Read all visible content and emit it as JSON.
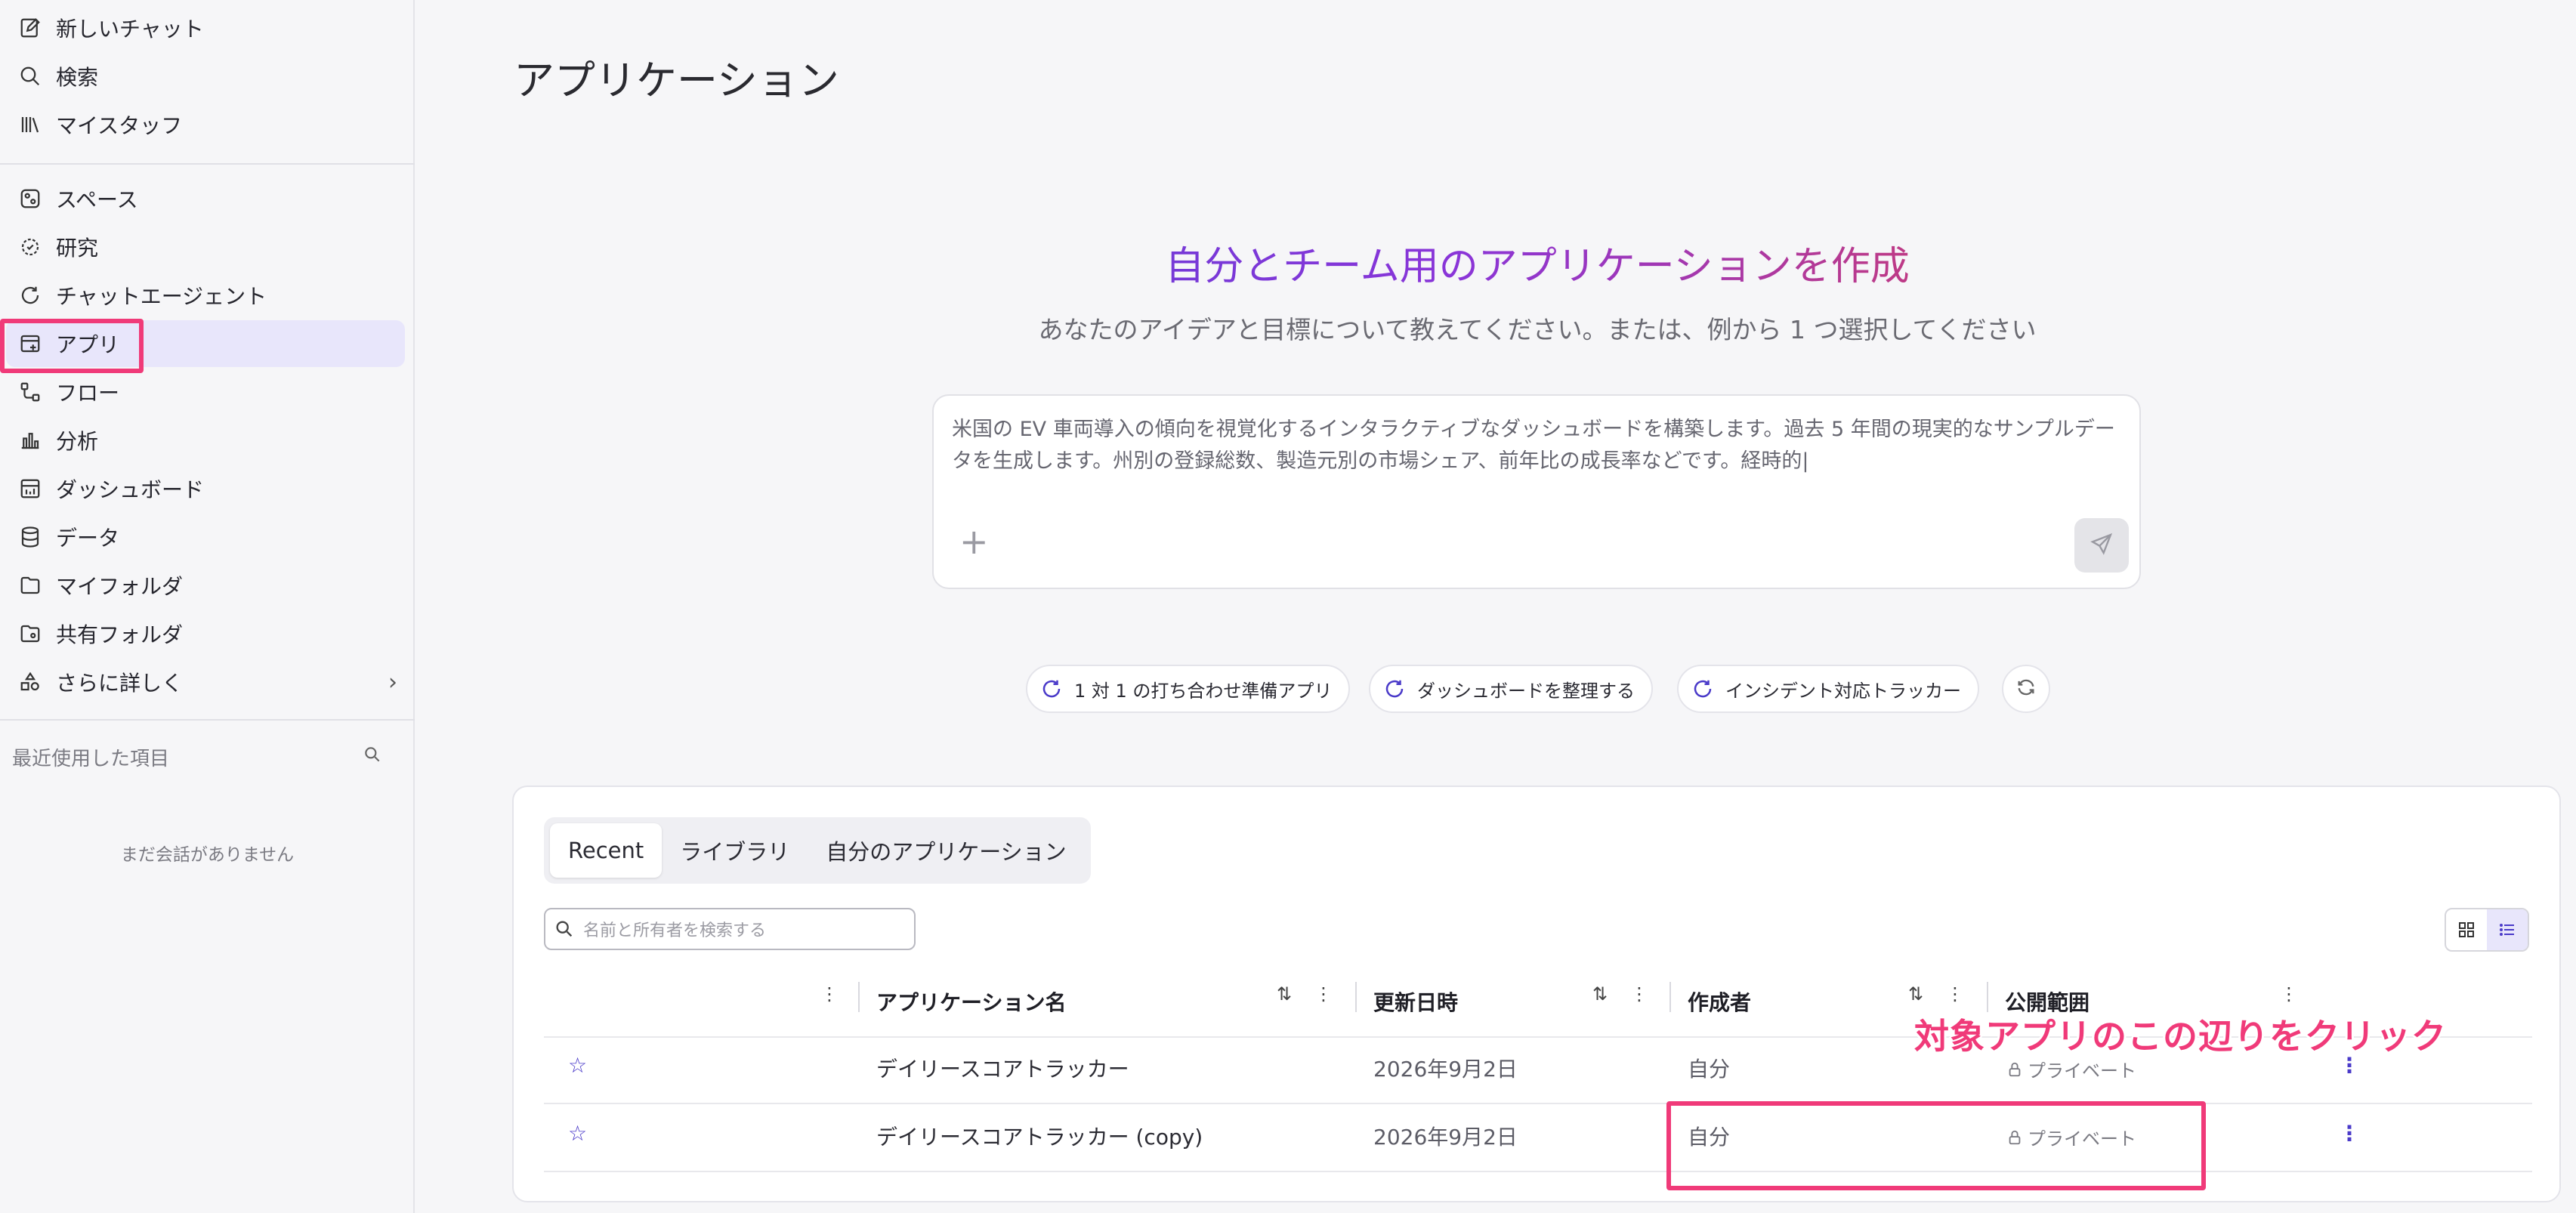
{
  "sidebar": {
    "items": [
      {
        "label": "新しいチャット",
        "icon": "edit-icon"
      },
      {
        "label": "検索",
        "icon": "search-icon"
      },
      {
        "label": "マイスタッフ",
        "icon": "library-icon"
      },
      {
        "label": "スペース",
        "icon": "spaces-icon"
      },
      {
        "label": "研究",
        "icon": "research-icon"
      },
      {
        "label": "チャットエージェント",
        "icon": "chat-agent-icon"
      },
      {
        "label": "アプリ",
        "icon": "app-icon"
      },
      {
        "label": "フロー",
        "icon": "flow-icon"
      },
      {
        "label": "分析",
        "icon": "chart-icon"
      },
      {
        "label": "ダッシュボード",
        "icon": "dashboard-icon"
      },
      {
        "label": "データ",
        "icon": "database-icon"
      },
      {
        "label": "マイフォルダ",
        "icon": "folder-icon"
      },
      {
        "label": "共有フォルダ",
        "icon": "shared-folder-icon"
      },
      {
        "label": "さらに詳しく",
        "icon": "shapes-icon"
      }
    ],
    "recent_label": "最近使用した項目",
    "empty_text": "まだ会話がありません"
  },
  "main": {
    "page_title": "アプリケーション",
    "hero_title": "自分とチーム用のアプリケーションを作成",
    "hero_subtitle": "あなたのアイデアと目標について教えてください。または、例から 1 つ選択してください",
    "prompt_text": "米国の EV 車両導入の傾向を視覚化するインタラクティブなダッシュボードを構築します。過去 5 年間の現実的なサンプルデータを生成します。州別の登録総数、製造元別の市場シェア、前年比の成長率などです。経時的|",
    "suggestions": [
      "1 対 1 の打ち合わせ準備アプリ",
      "ダッシュボードを整理する",
      "インシデント対応トラッカー"
    ]
  },
  "apps": {
    "tabs": [
      "Recent",
      "ライブラリ",
      "自分のアプリケーション"
    ],
    "search_placeholder": "名前と所有者を検索する",
    "columns": [
      "アプリケーション名",
      "更新日時",
      "作成者",
      "公開範囲"
    ],
    "rows": [
      {
        "name": "デイリースコアトラッカー",
        "updated": "2026年9月2日",
        "creator": "自分",
        "visibility": "プライベート"
      },
      {
        "name": "デイリースコアトラッカー (copy)",
        "updated": "2026年9月2日",
        "creator": "自分",
        "visibility": "プライベート"
      }
    ]
  },
  "annotation": {
    "text": "対象アプリのこの辺りをクリック",
    "color": "#f03a79"
  },
  "colors": {
    "accent": "#4a3ac9",
    "active_bg": "#e8e6fb",
    "highlight": "#f03a79"
  }
}
